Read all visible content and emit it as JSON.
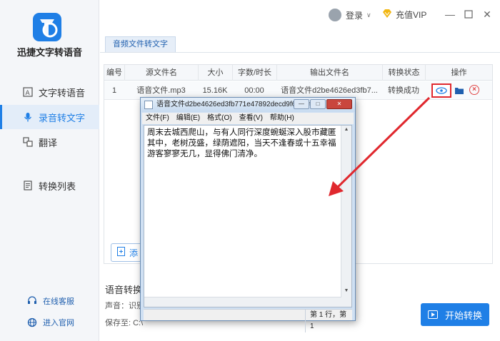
{
  "app": {
    "name": "迅捷文字转语音"
  },
  "sidebar": {
    "items": [
      {
        "label": "文字转语音",
        "icon": "text-icon",
        "active": false
      },
      {
        "label": "录音转文字",
        "icon": "microphone-icon",
        "active": true
      },
      {
        "label": "翻译",
        "icon": "translate-icon",
        "active": false
      },
      {
        "label": "转换列表",
        "icon": "list-icon",
        "active": false
      }
    ],
    "bottom_links": [
      {
        "label": "在线客服",
        "icon": "headset-icon"
      },
      {
        "label": "进入官网",
        "icon": "globe-icon"
      }
    ]
  },
  "topbar": {
    "login_label": "登录",
    "vip_label": "充值VIP"
  },
  "tab": {
    "label": "音频文件转文字"
  },
  "table": {
    "headers": [
      "编号",
      "源文件名",
      "大小",
      "字数/时长",
      "输出文件名",
      "转换状态",
      "操作"
    ],
    "rows": [
      {
        "no": "1",
        "source": "语音文件.mp3",
        "size": "15.16K",
        "duration": "00:00",
        "output": "语音文件d2be4626ed3fb7...",
        "status": "转换成功"
      }
    ]
  },
  "add_button": {
    "label": "添"
  },
  "settings": {
    "title": "语音转换",
    "voice_label": "声音：识别",
    "save_label": "保存至: C:\\"
  },
  "start_button": {
    "label": "开始转换"
  },
  "notepad": {
    "title": "语音文件d2be4626ed3fb771e47892decd9f6cd1.tx...",
    "menu": [
      "文件(F)",
      "编辑(E)",
      "格式(O)",
      "查看(V)",
      "帮助(H)"
    ],
    "content": "周末去城西爬山，与有人同行深度蜿蜒深入股市藏匿其中，老树茂盛，绿荫遮阳，当天不逢春或十五幸福游客寥寥无几，显得佛门清净。",
    "status": "第 1 行，第 1"
  },
  "colors": {
    "accent": "#1f7fe6",
    "highlight_border": "#e0282e",
    "arrow": "#e0282e"
  }
}
